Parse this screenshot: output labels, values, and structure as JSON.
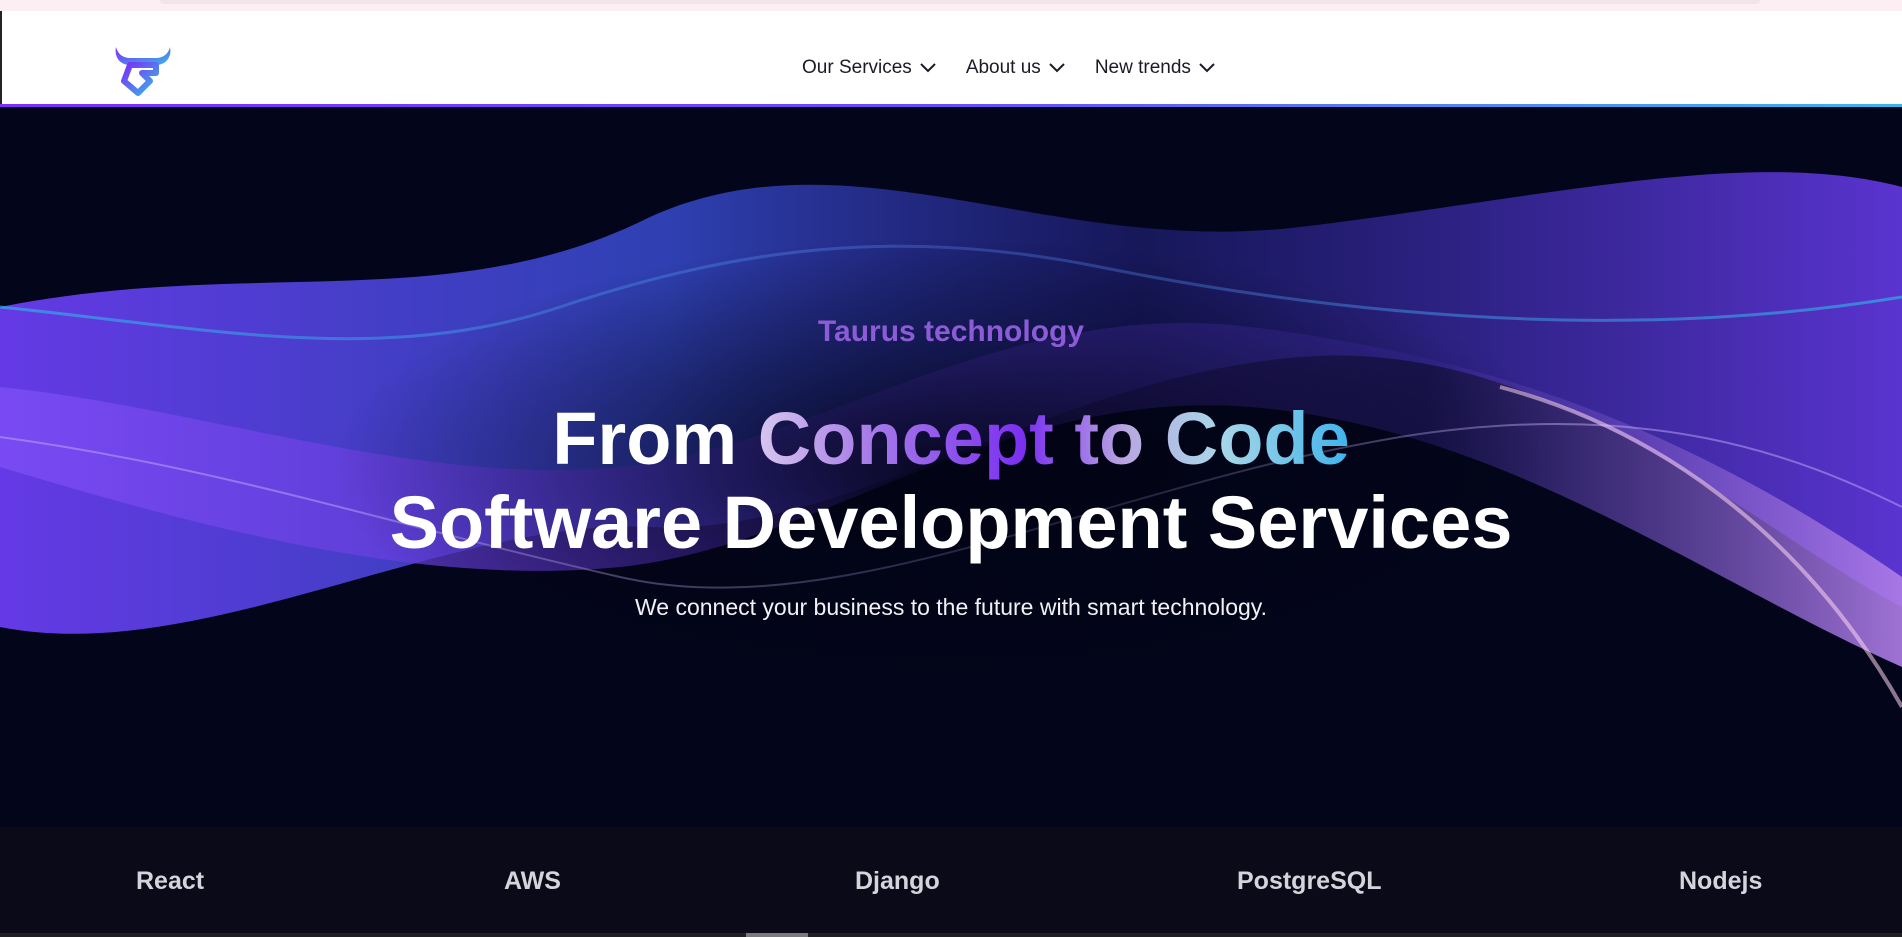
{
  "nav": {
    "items": [
      {
        "label": "Our Services"
      },
      {
        "label": "About us"
      },
      {
        "label": "New trends"
      }
    ]
  },
  "hero": {
    "kicker": "Taurus technology",
    "headline_part1": "From ",
    "headline_gradient": "Concept to Code",
    "headline_line2": "Software Development Services",
    "subline": "We connect your business to the future with smart technology."
  },
  "tech_stack": [
    "React",
    "AWS",
    "Django",
    "PostgreSQL",
    "Nodejs"
  ],
  "colors": {
    "accent_purple": "#7a2ff0",
    "accent_blue": "#3fb3ec",
    "kicker": "#8b5cd6",
    "hero_bg": "#03051a"
  }
}
